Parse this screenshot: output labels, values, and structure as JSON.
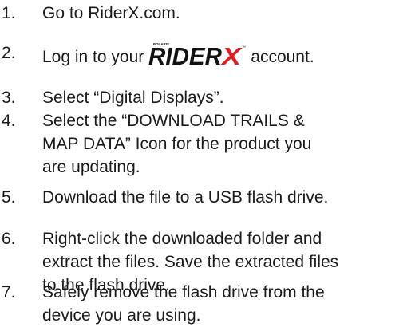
{
  "steps": [
    {
      "num": "1.",
      "text": "Go to RiderX.com."
    },
    {
      "num": "2.",
      "pre": "Log in to your",
      "logo_text": "RIDERX",
      "logo_small": "POLARIS",
      "post": "account."
    },
    {
      "num": "3.",
      "text": "Select “Digital Displays”."
    },
    {
      "num": "4.",
      "lines": [
        "Select the “DOWNLOAD TRAILS &",
        "MAP DATA” Icon for the product you",
        "are updating."
      ]
    },
    {
      "num": "5.",
      "text": "Download the file to a USB flash drive."
    },
    {
      "num": "6.",
      "lines": [
        "Right-click the downloaded folder and",
        "extract the files. Save the extracted files",
        "to the flash drive."
      ]
    },
    {
      "num": "7.",
      "lines": [
        "Safely remove the flash drive from the",
        "device you are using."
      ]
    }
  ],
  "colors": {
    "text": "#1a1a1a",
    "logo_dark": "#111111",
    "logo_red": "#d8222a"
  }
}
